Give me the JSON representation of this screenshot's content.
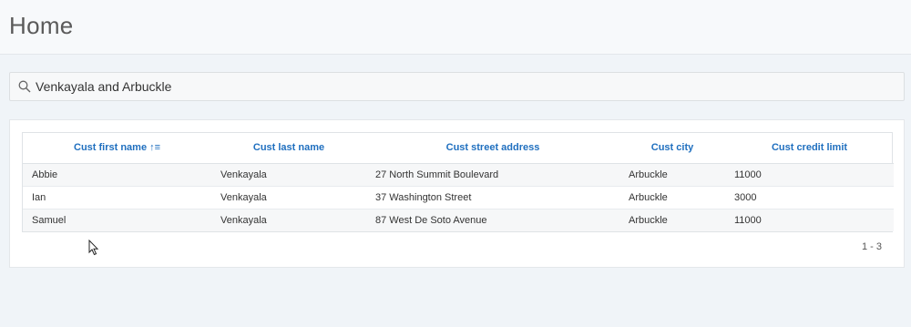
{
  "header": {
    "title": "Home"
  },
  "search": {
    "value": "Venkayala and Arbuckle"
  },
  "table": {
    "columns": [
      "Cust first name",
      "Cust last name",
      "Cust street address",
      "Cust city",
      "Cust credit limit"
    ],
    "sort_indicator": "↑≡",
    "rows": [
      [
        "Abbie",
        "Venkayala",
        "27 North Summit Boulevard",
        "Arbuckle",
        "11000"
      ],
      [
        "Ian",
        "Venkayala",
        "37 Washington Street",
        "Arbuckle",
        "3000"
      ],
      [
        "Samuel",
        "Venkayala",
        "87 West De Soto Avenue",
        "Arbuckle",
        "11000"
      ]
    ]
  },
  "pagination": {
    "text": "1 - 3"
  },
  "colors": {
    "header_text": "#1f6fbf",
    "background": "#f0f4f8"
  }
}
